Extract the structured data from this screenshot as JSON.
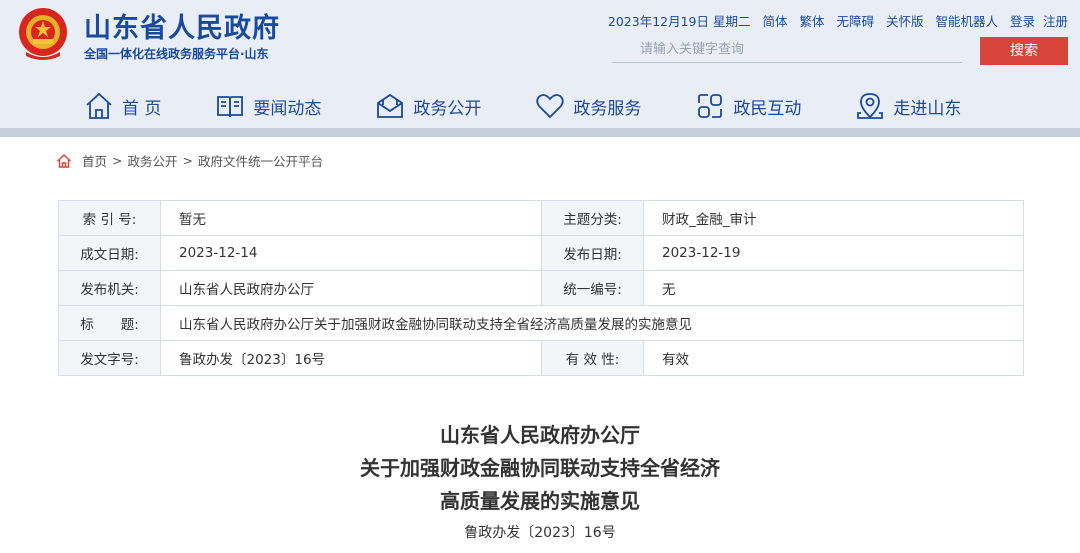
{
  "header": {
    "title": "山东省人民政府",
    "subtitle": "全国一体化在线政务服务平台·山东",
    "date": "2023年12月19日 星期二",
    "links": [
      "简体",
      "繁体",
      "无障碍",
      "关怀版",
      "智能机器人",
      "登录",
      "注册"
    ],
    "search_placeholder": "请输入关键字查询",
    "search_button": "搜索",
    "colors": {
      "brand": "#1a4a9c",
      "accent": "#d9453a"
    }
  },
  "nav": [
    {
      "label": "首 页",
      "icon": "home-icon"
    },
    {
      "label": "要闻动态",
      "icon": "book-icon"
    },
    {
      "label": "政务公开",
      "icon": "mail-icon"
    },
    {
      "label": "政务服务",
      "icon": "heart-icon"
    },
    {
      "label": "政民互动",
      "icon": "interaction-icon"
    },
    {
      "label": "走进山东",
      "icon": "location-icon"
    }
  ],
  "breadcrumb": [
    "首页",
    "政务公开",
    "政府文件统一公开平台"
  ],
  "meta": {
    "index_label": "索 引 号:",
    "index_value": "暂无",
    "category_label": "主题分类:",
    "category_value": "财政_金融_审计",
    "created_label": "成文日期:",
    "created_value": "2023-12-14",
    "published_label": "发布日期:",
    "published_value": "2023-12-19",
    "org_label": "发布机关:",
    "org_value": "山东省人民政府办公厅",
    "number_label": "统一编号:",
    "number_value": "无",
    "title_label": "标　　题:",
    "title_value": "山东省人民政府办公厅关于加强财政金融协同联动支持全省经济高质量发展的实施意见",
    "docno_label": "发文字号:",
    "docno_value": "鲁政办发〔2023〕16号",
    "validity_label": "有 效 性:",
    "validity_value": "有效"
  },
  "document": {
    "title_lines": [
      "山东省人民政府办公厅",
      "关于加强财政金融协同联动支持全省经济",
      "高质量发展的实施意见"
    ],
    "doc_number": "鲁政办发〔2023〕16号"
  }
}
